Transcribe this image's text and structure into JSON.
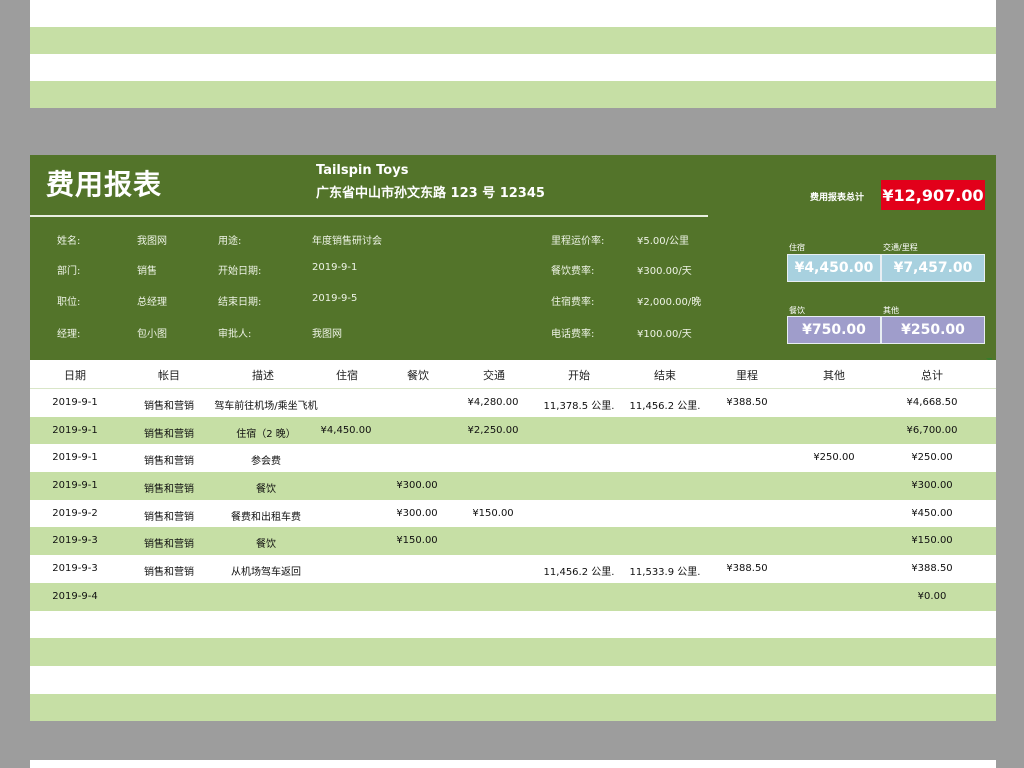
{
  "report": {
    "title": "费用报表",
    "company": "Tailspin Toys",
    "address": "广东省中山市孙文东路 123 号 12345"
  },
  "info": {
    "name_label": "姓名:",
    "name_value": "我图网",
    "dept_label": "部门:",
    "dept_value": "销售",
    "position_label": "职位:",
    "position_value": "总经理",
    "manager_label": "经理:",
    "manager_value": "包小图",
    "purpose_label": "用途:",
    "purpose_value": "年度销售研讨会",
    "start_label": "开始日期:",
    "start_value": "2019-9-1",
    "end_label": "结束日期:",
    "end_value": "2019-9-5",
    "approver_label": "审批人:",
    "approver_value": "我图网",
    "mileage_rate_label": "里程运价率:",
    "mileage_rate_value": "¥5.00/公里",
    "meal_rate_label": "餐饮费率:",
    "meal_rate_value": "¥300.00/天",
    "lodging_rate_label": "住宿费率:",
    "lodging_rate_value": "¥2,000.00/晚",
    "phone_rate_label": "电话费率:",
    "phone_rate_value": "¥100.00/天"
  },
  "summary": {
    "total_label": "费用报表总计",
    "total_value": "¥12,907.00",
    "lodging_label": "住宿",
    "lodging_value": "¥4,450.00",
    "transport_label": "交通/里程",
    "transport_value": "¥7,457.00",
    "meals_label": "餐饮",
    "meals_value": "¥750.00",
    "other_label": "其他",
    "other_value": "¥250.00"
  },
  "colors": {
    "header_green": "#53742a",
    "band_green": "#c6dfa5",
    "total_red": "#e2001a",
    "card_blue": "#a8d1df",
    "card_purple": "#9f9dcb"
  },
  "table": {
    "columns": [
      "日期",
      "帐目",
      "描述",
      "住宿",
      "餐饮",
      "交通",
      "开始",
      "结束",
      "里程",
      "其他",
      "总计"
    ],
    "rows": [
      {
        "date": "2019-9-1",
        "account": "销售和营销",
        "desc": "驾车前往机场/乘坐飞机",
        "lodging": "",
        "meals": "",
        "transport": "¥4,280.00",
        "start": "11,378.5 公里.",
        "end": "11,456.2 公里.",
        "mileage": "¥388.50",
        "other": "",
        "total": "¥4,668.50"
      },
      {
        "date": "2019-9-1",
        "account": "销售和营销",
        "desc": "住宿（2 晚）",
        "lodging": "¥4,450.00",
        "meals": "",
        "transport": "¥2,250.00",
        "start": "",
        "end": "",
        "mileage": "",
        "other": "",
        "total": "¥6,700.00"
      },
      {
        "date": "2019-9-1",
        "account": "销售和营销",
        "desc": "参会费",
        "lodging": "",
        "meals": "",
        "transport": "",
        "start": "",
        "end": "",
        "mileage": "",
        "other": "¥250.00",
        "total": "¥250.00"
      },
      {
        "date": "2019-9-1",
        "account": "销售和营销",
        "desc": "餐饮",
        "lodging": "",
        "meals": "¥300.00",
        "transport": "",
        "start": "",
        "end": "",
        "mileage": "",
        "other": "",
        "total": "¥300.00"
      },
      {
        "date": "2019-9-2",
        "account": "销售和营销",
        "desc": "餐费和出租车费",
        "lodging": "",
        "meals": "¥300.00",
        "transport": "¥150.00",
        "start": "",
        "end": "",
        "mileage": "",
        "other": "",
        "total": "¥450.00"
      },
      {
        "date": "2019-9-3",
        "account": "销售和营销",
        "desc": "餐饮",
        "lodging": "",
        "meals": "¥150.00",
        "transport": "",
        "start": "",
        "end": "",
        "mileage": "",
        "other": "",
        "total": "¥150.00"
      },
      {
        "date": "2019-9-3",
        "account": "销售和营销",
        "desc": "从机场驾车返回",
        "lodging": "",
        "meals": "",
        "transport": "",
        "start": "11,456.2 公里.",
        "end": "11,533.9 公里.",
        "mileage": "¥388.50",
        "other": "",
        "total": "¥388.50"
      },
      {
        "date": "2019-9-4",
        "account": "",
        "desc": "",
        "lodging": "",
        "meals": "",
        "transport": "",
        "start": "",
        "end": "",
        "mileage": "",
        "other": "",
        "total": "¥0.00"
      }
    ]
  }
}
